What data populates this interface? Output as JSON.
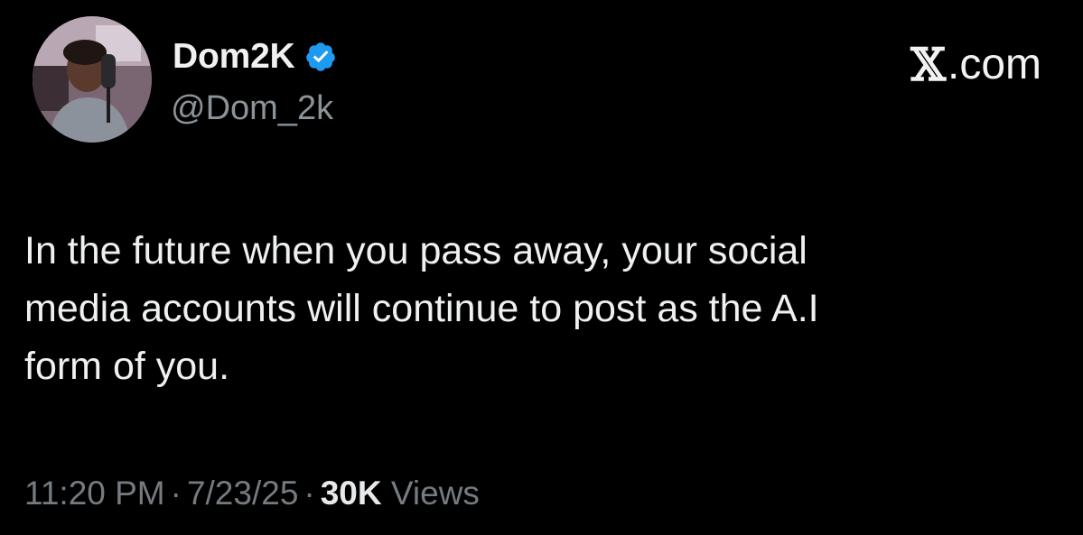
{
  "author": {
    "display_name": "Dom2K",
    "handle": "@Dom_2k",
    "verified": true,
    "verified_icon": "verified-badge-icon",
    "verified_color": "#1d9bf0"
  },
  "brand": {
    "text": ".com",
    "logo_char": "𝕏"
  },
  "tweet": {
    "lines": [
      "In the future when you pass away, your social",
      "media accounts will continue to post as the A.I",
      "form of you."
    ]
  },
  "meta": {
    "time": "11:20 PM",
    "separator": "·",
    "date": "7/23/25",
    "views_count": "30K",
    "views_label": "Views"
  },
  "colors": {
    "background": "#000000",
    "text_primary": "#e7e9ea",
    "text_secondary": "#757b80"
  }
}
